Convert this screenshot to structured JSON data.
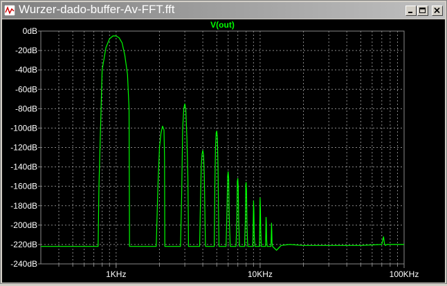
{
  "window": {
    "title": "Wurzer-dado-buffer-Av-FFT.fft",
    "icons": {
      "app": "waveform-icon",
      "minimize": "minimize-icon",
      "maximize": "maximize-icon",
      "close": "close-icon"
    }
  },
  "colors": {
    "background": "#000000",
    "grid": "#8a8a8a",
    "trace": "#00ff00",
    "axis_text": "#ffffff"
  },
  "chart_data": {
    "type": "line",
    "title": "",
    "xlabel": "",
    "ylabel": "",
    "x_scale": "log",
    "xlim": [
      300,
      100000
    ],
    "ylim": [
      -240,
      0
    ],
    "grid": true,
    "y_ticks": [
      0,
      -20,
      -40,
      -60,
      -80,
      -100,
      -120,
      -140,
      -160,
      -180,
      -200,
      -220,
      -240
    ],
    "y_tick_labels": [
      "0dB",
      "-20dB",
      "-40dB",
      "-60dB",
      "-80dB",
      "-100dB",
      "-120dB",
      "-140dB",
      "-160dB",
      "-180dB",
      "-200dB",
      "-220dB",
      "-240dB"
    ],
    "x_ticks": [
      1000,
      10000,
      100000
    ],
    "x_tick_labels": [
      "1KHz",
      "10KHz",
      "100KHz"
    ],
    "series": [
      {
        "name": "V(out)",
        "color": "#00ff00",
        "x": [
          300,
          750,
          760,
          800,
          850,
          900,
          950,
          1000,
          1050,
          1100,
          1150,
          1200,
          1230,
          1240,
          1300,
          1900,
          1950,
          2000,
          2050,
          2100,
          2150,
          2170,
          2180,
          2800,
          2850,
          2900,
          2950,
          3000,
          3050,
          3100,
          3150,
          3170,
          3180,
          3800,
          3850,
          3900,
          3950,
          4000,
          4050,
          4100,
          4150,
          4170,
          4180,
          4800,
          4850,
          4900,
          4950,
          5000,
          5050,
          5100,
          5150,
          5170,
          5180,
          5800,
          5900,
          5950,
          6000,
          6050,
          6100,
          6200,
          6800,
          6900,
          6950,
          7000,
          7050,
          7100,
          7200,
          7800,
          7900,
          7950,
          8000,
          8050,
          8100,
          8200,
          8900,
          8950,
          9000,
          9050,
          9100,
          9200,
          9900,
          9950,
          10000,
          10050,
          10100,
          10200,
          10900,
          10950,
          11000,
          11050,
          11100,
          11200,
          11900,
          11950,
          12000,
          12050,
          12100,
          12200,
          13000,
          14000,
          16000,
          20000,
          30000,
          50000,
          70000,
          72000,
          73000,
          74000,
          76000,
          80000,
          100000
        ],
        "y": [
          -222,
          -222,
          -160,
          -40,
          -17,
          -8,
          -5,
          -5,
          -7,
          -12,
          -25,
          -45,
          -80,
          -222,
          -222,
          -222,
          -160,
          -120,
          -105,
          -98,
          -102,
          -130,
          -222,
          -222,
          -170,
          -100,
          -80,
          -75,
          -82,
          -110,
          -150,
          -190,
          -222,
          -222,
          -180,
          -140,
          -127,
          -123,
          -128,
          -150,
          -200,
          -220,
          -222,
          -222,
          -160,
          -120,
          -105,
          -103,
          -110,
          -140,
          -190,
          -210,
          -222,
          -222,
          -180,
          -150,
          -145,
          -152,
          -190,
          -222,
          -222,
          -190,
          -155,
          -152,
          -160,
          -195,
          -222,
          -222,
          -195,
          -158,
          -156,
          -165,
          -200,
          -222,
          -222,
          -200,
          -175,
          -185,
          -210,
          -222,
          -222,
          -196,
          -172,
          -184,
          -205,
          -222,
          -222,
          -210,
          -192,
          -198,
          -215,
          -222,
          -222,
          -212,
          -198,
          -206,
          -218,
          -222,
          -226,
          -221,
          -220,
          -221,
          -221,
          -221,
          -220,
          -212,
          -219,
          -221,
          -220,
          -220,
          -220
        ]
      }
    ]
  }
}
